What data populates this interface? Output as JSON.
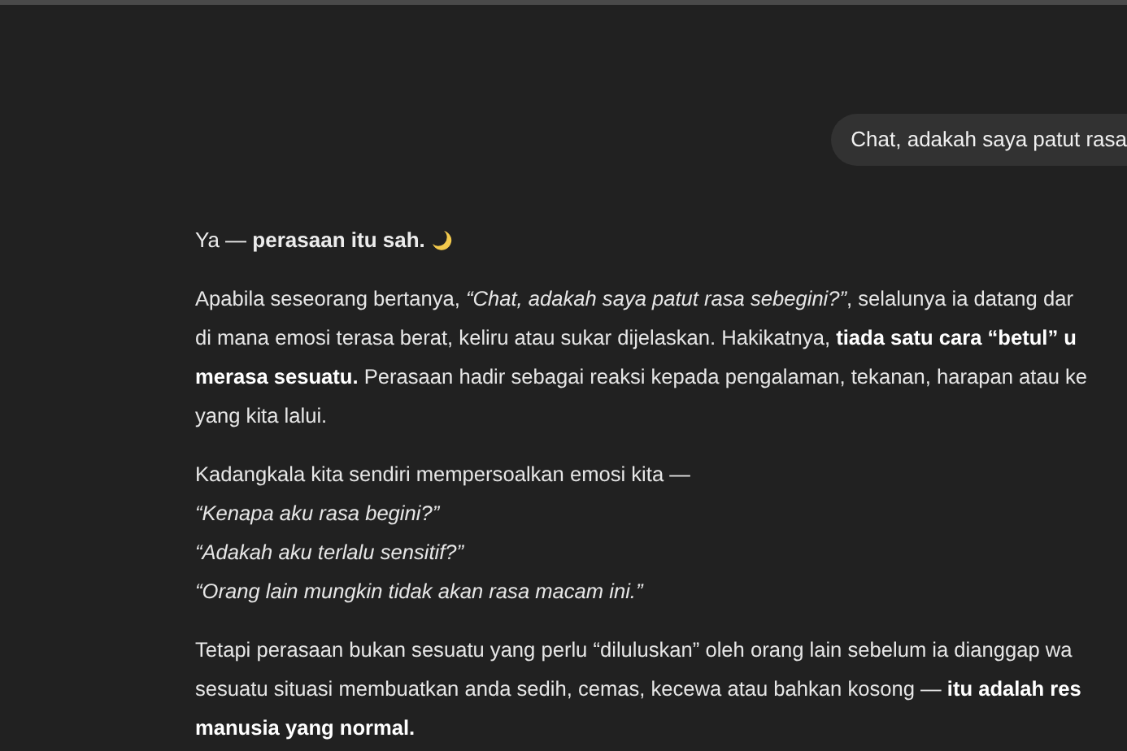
{
  "user_message": "Chat, adakah saya patut rasa",
  "reply": {
    "heading": "Ya — **perasaan itu sah.**",
    "paragraphs": [
      {
        "lines": [
          "Apabila seseorang bertanya, *“Chat, adakah saya patut rasa sebegini?”*, selalunya ia datang dar",
          "di mana emosi terasa berat, keliru atau sukar dijelaskan. Hakikatnya, **tiada satu cara “betul” u**",
          "**merasa sesuatu.** Perasaan hadir sebagai reaksi kepada pengalaman, tekanan, harapan atau ke",
          "yang kita lalui."
        ]
      },
      {
        "lines": [
          "Kadangkala kita sendiri mempersoalkan emosi kita —",
          "*“Kenapa aku rasa begini?”*",
          "*“Adakah aku terlalu sensitif?”*",
          "*“Orang lain mungkin tidak akan rasa macam ini.”*"
        ]
      },
      {
        "lines": [
          "Tetapi perasaan bukan sesuatu yang perlu “diluluskan” oleh orang lain sebelum ia dianggap wa",
          "sesuatu situasi membuatkan anda sedih, cemas, kecewa atau bahkan kosong — **itu adalah res**",
          "**manusia yang normal.**"
        ]
      }
    ]
  }
}
